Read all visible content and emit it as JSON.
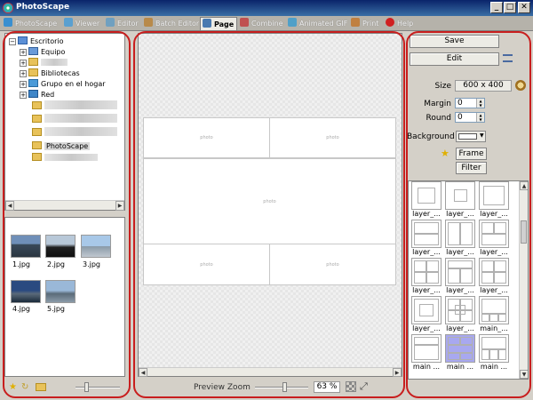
{
  "window": {
    "title": "PhotoScape",
    "min_glyph": "_",
    "max_glyph": "□",
    "close_glyph": "✕"
  },
  "tabs": [
    {
      "label": "PhotoScape",
      "icon": "photoscape-icon",
      "color": "#3a8fd0"
    },
    {
      "label": "Viewer",
      "icon": "viewer-icon",
      "color": "#5aa0d0"
    },
    {
      "label": "Editor",
      "icon": "editor-icon",
      "color": "#70a0c0"
    },
    {
      "label": "Batch Editor",
      "icon": "batch-editor-icon",
      "color": "#b88a4a"
    },
    {
      "label": "Page",
      "icon": "page-icon",
      "color": "#4a7ab0",
      "active": true
    },
    {
      "label": "Combine",
      "icon": "combine-icon",
      "color": "#c05050"
    },
    {
      "label": "Animated GIF",
      "icon": "animated-gif-icon",
      "color": "#50a0c8"
    },
    {
      "label": "Print",
      "icon": "print-icon",
      "color": "#c08040"
    },
    {
      "label": "Help",
      "icon": "help-icon",
      "color": "#d02020"
    }
  ],
  "tree": {
    "root": "Escritorio",
    "items": [
      {
        "label": "Equipo",
        "icon": "computer-icon",
        "expand": "+"
      },
      {
        "label": "",
        "icon": "user-folder-icon",
        "expand": "+",
        "blur": true
      },
      {
        "label": "Bibliotecas",
        "icon": "libraries-icon",
        "expand": "+"
      },
      {
        "label": "Grupo en el hogar",
        "icon": "homegroup-icon",
        "expand": "+"
      },
      {
        "label": "Red",
        "icon": "network-icon",
        "expand": "+"
      },
      {
        "label": "",
        "icon": "folder-icon",
        "blur": true
      },
      {
        "label": "",
        "icon": "folder-icon",
        "blur": true
      },
      {
        "label": "",
        "icon": "folder-icon",
        "blur": true
      },
      {
        "label": "PhotoScape",
        "icon": "folder-icon",
        "selected": true
      },
      {
        "label": "",
        "icon": "folder-icon",
        "blur": true
      }
    ]
  },
  "thumbnails": [
    "1.jpg",
    "2.jpg",
    "3.jpg",
    "4.jpg",
    "5.jpg"
  ],
  "layout_cells": [
    "photo",
    "photo",
    "photo",
    "photo",
    "photo"
  ],
  "preview": {
    "zoom_label": "Preview Zoom",
    "zoom_value": "63 %"
  },
  "right": {
    "save": "Save",
    "edit": "Edit",
    "size_label": "Size",
    "size_value": "600 x 400",
    "margin_label": "Margin",
    "margin_value": "0",
    "round_label": "Round",
    "round_value": "0",
    "background_label": "Background",
    "frame": "Frame",
    "filter": "Filter"
  },
  "layouts": [
    "layer_...",
    "layer_...",
    "layer_...",
    "layer_...",
    "layer_...",
    "layer_...",
    "layer_...",
    "layer_...",
    "layer_...",
    "layer_...",
    "layer_...",
    "layer_...",
    "layer_...",
    "layer_...",
    "main_...",
    "main ...",
    "main ...",
    "main ..."
  ]
}
